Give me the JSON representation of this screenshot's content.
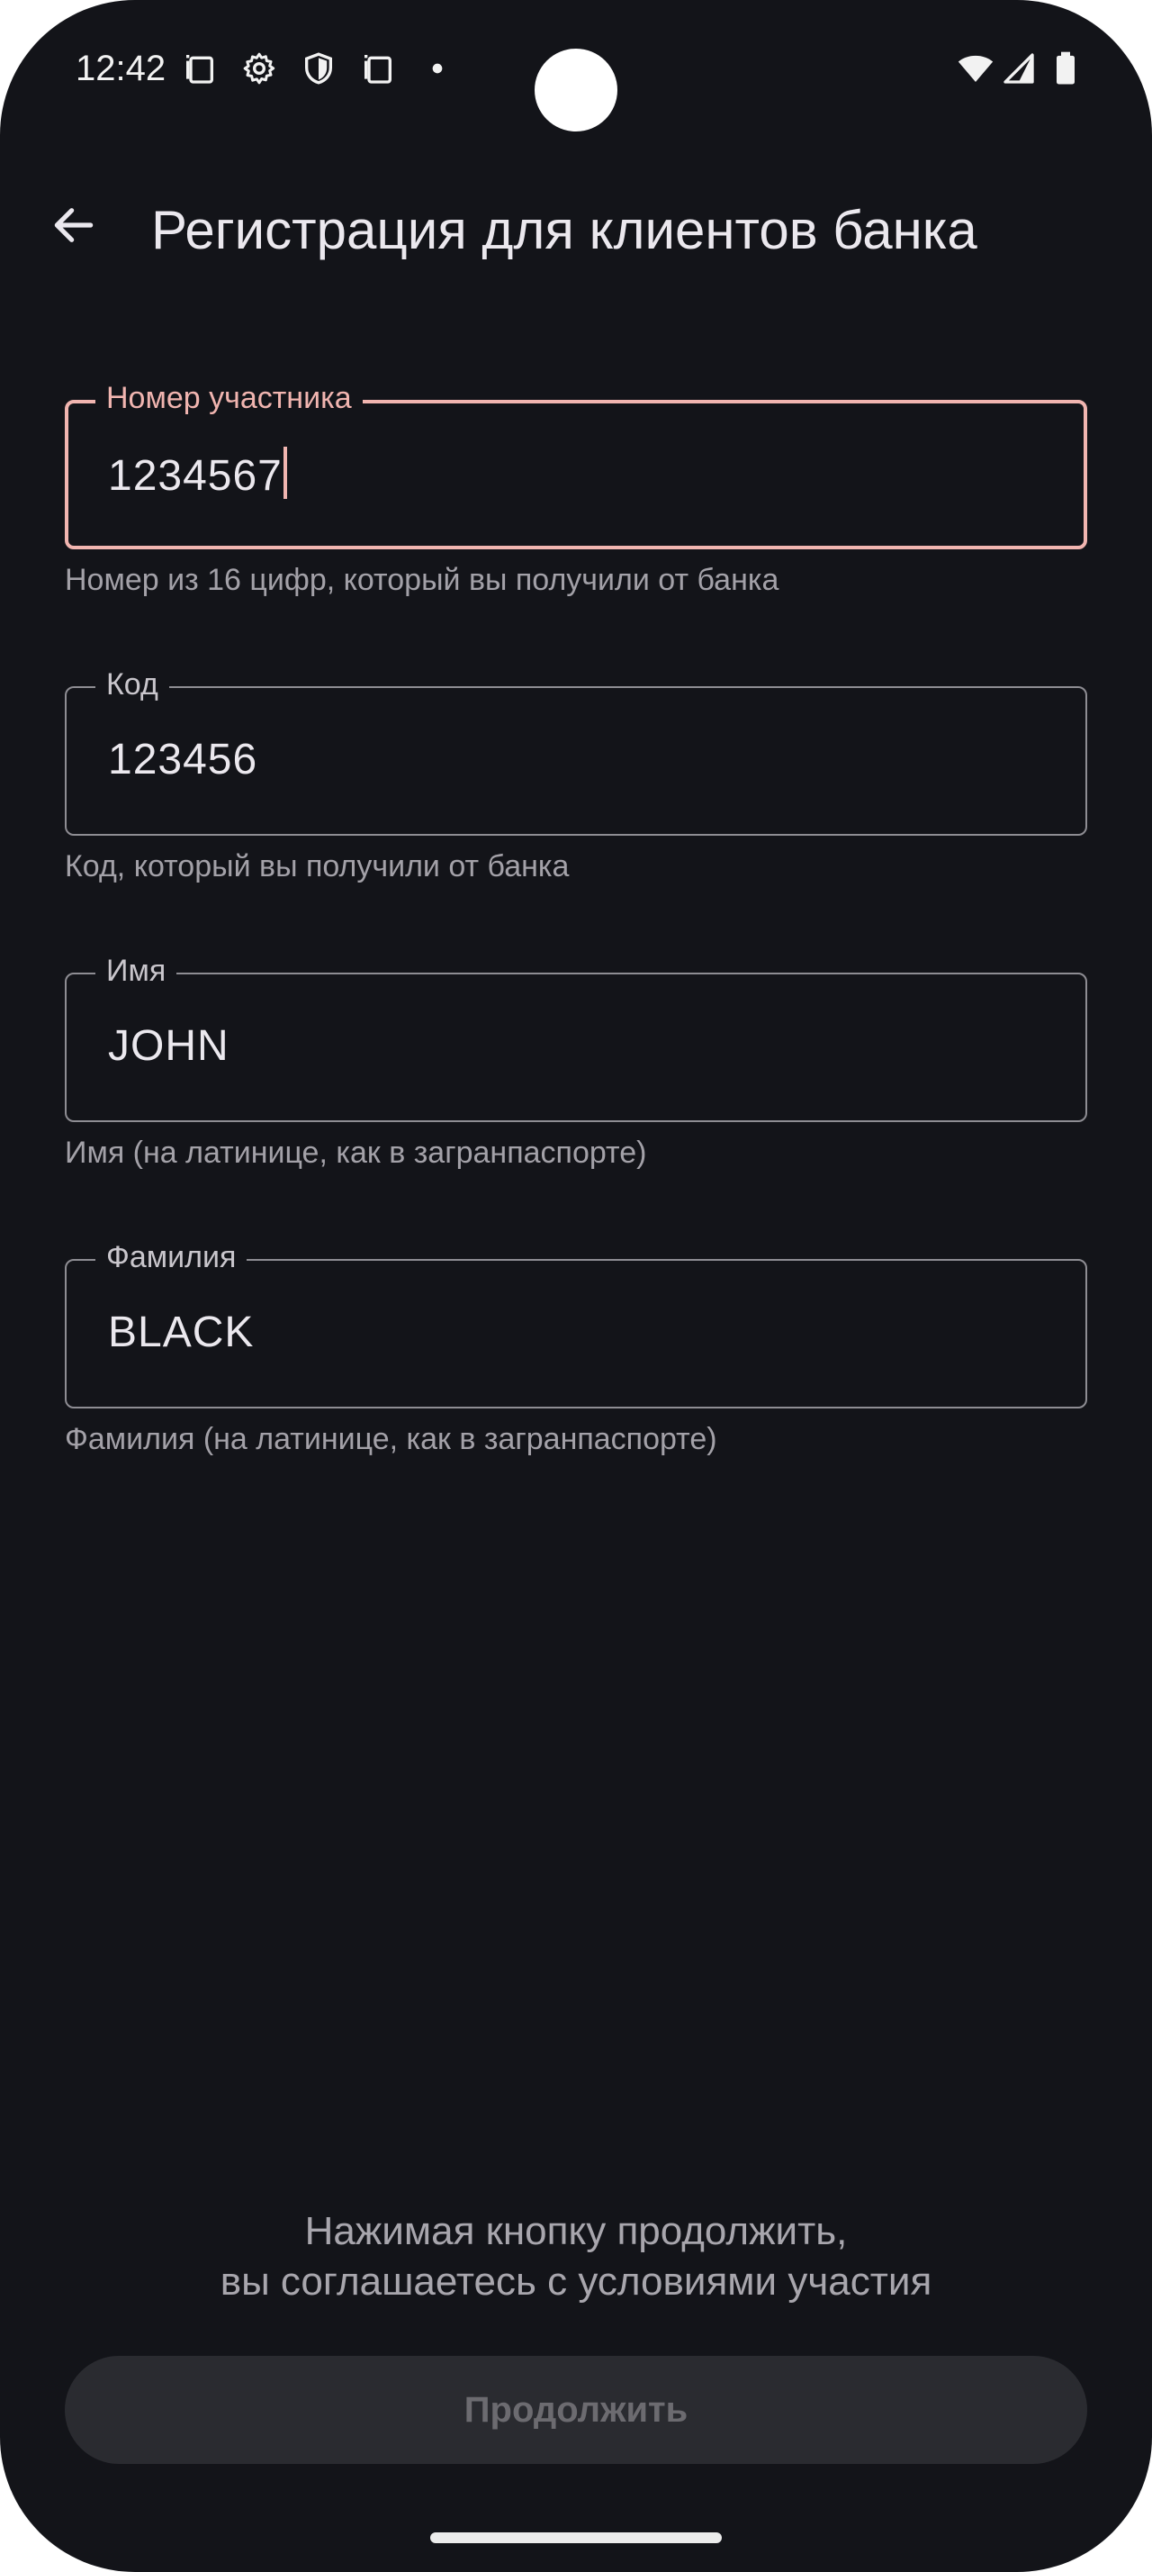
{
  "status_bar": {
    "time": "12:42",
    "left_icons": [
      "screenshot-icon",
      "gear-icon",
      "shield-icon",
      "screenshot-icon",
      "dot-icon"
    ],
    "right_icons": [
      "wifi-icon",
      "signal-icon",
      "battery-icon"
    ]
  },
  "app_bar": {
    "back_icon": "arrow-left-icon",
    "title": "Регистрация для клиентов банка"
  },
  "fields": [
    {
      "label": "Номер участника",
      "value": "1234567",
      "helper": "Номер из 16 цифр, который вы получили от банка",
      "focused": true
    },
    {
      "label": "Код",
      "value": "123456",
      "helper": "Код, который вы получили от банка",
      "focused": false
    },
    {
      "label": "Имя",
      "value": "JOHN",
      "helper": "Имя (на латинице, как в загранпаспорте)",
      "focused": false
    },
    {
      "label": "Фамилия",
      "value": "BLACK",
      "helper": "Фамилия (на латинице, как в загранпаспорте)",
      "focused": false
    }
  ],
  "footer": {
    "consent_line_1": "Нажимая кнопку продолжить,",
    "consent_line_2": "вы соглашаетесь с условиями участия",
    "continue_label": "Продолжить",
    "continue_enabled": false
  },
  "colors": {
    "background": "#131419",
    "accent": "#f1b5b0",
    "outline": "#8e8d93",
    "button_disabled_bg": "#2a2b30"
  }
}
